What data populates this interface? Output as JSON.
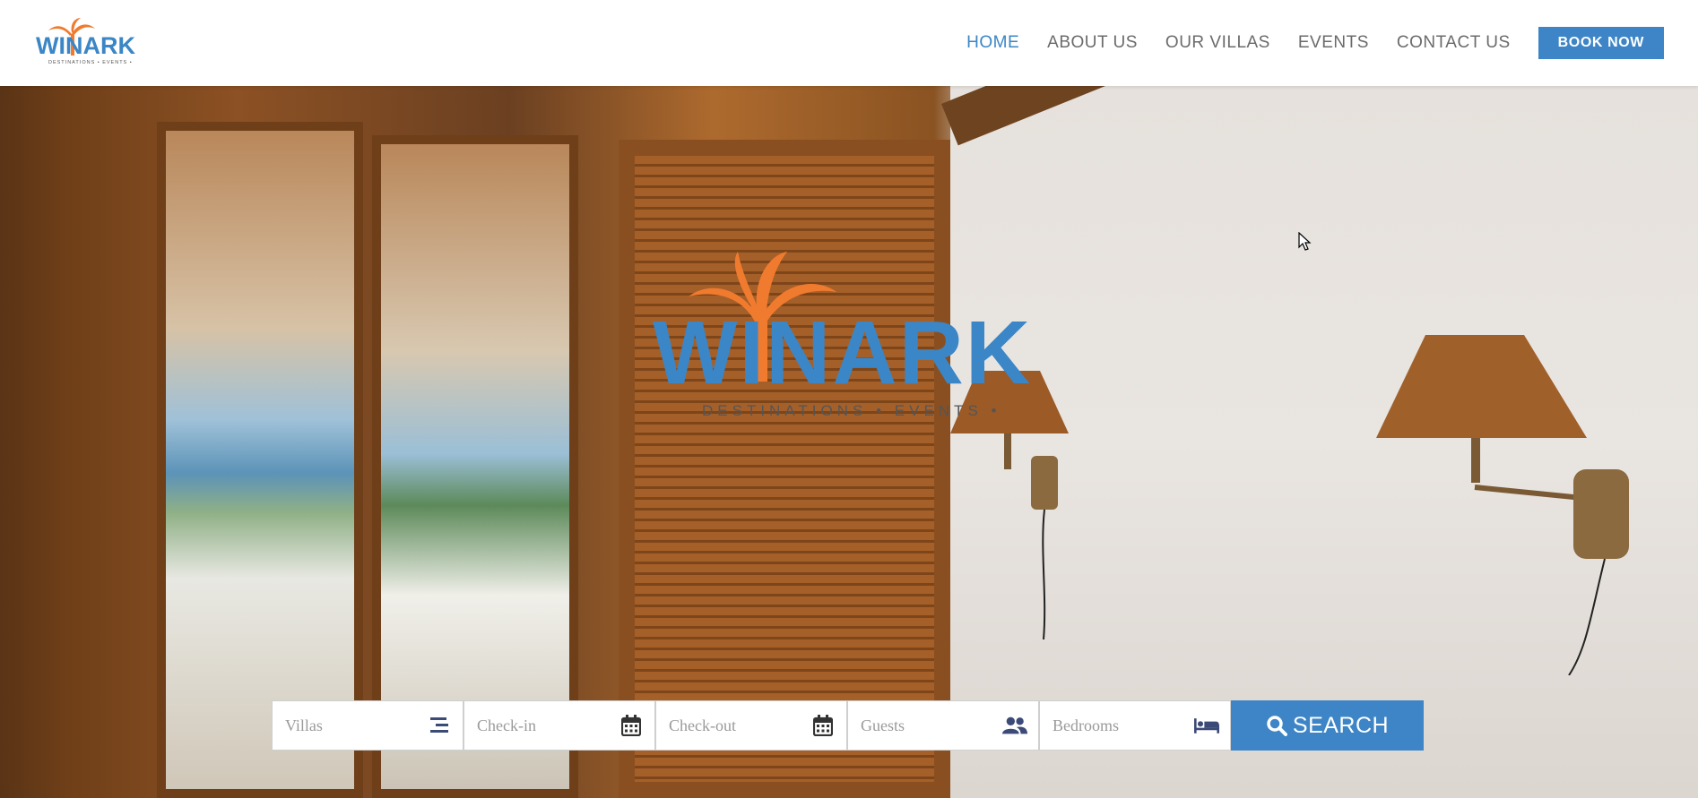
{
  "brand": {
    "name": "WINARK",
    "tagline": "DESTINATIONS • EVENTS •",
    "colors": {
      "blue": "#3b86c6",
      "orange": "#f07b2f"
    }
  },
  "nav": {
    "items": [
      {
        "label": "HOME",
        "active": true
      },
      {
        "label": "ABOUT US",
        "active": false
      },
      {
        "label": "OUR VILLAS",
        "active": false
      },
      {
        "label": "EVENTS",
        "active": false
      },
      {
        "label": "CONTACT US",
        "active": false
      }
    ],
    "book_label": "BOOK NOW"
  },
  "search": {
    "fields": [
      {
        "placeholder": "Villas",
        "icon": "list-icon"
      },
      {
        "placeholder": "Check-in",
        "icon": "calendar-icon"
      },
      {
        "placeholder": "Check-out",
        "icon": "calendar-icon"
      },
      {
        "placeholder": "Guests",
        "icon": "users-icon"
      },
      {
        "placeholder": "Bedrooms",
        "icon": "bed-icon"
      }
    ],
    "button_label": "SEARCH"
  }
}
